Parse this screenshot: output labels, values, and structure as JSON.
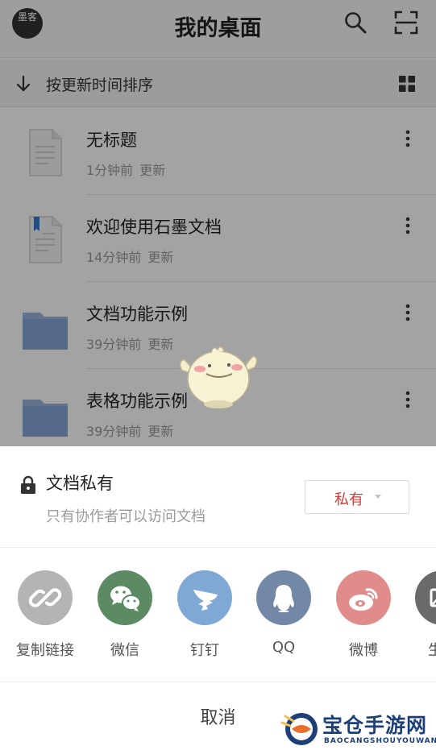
{
  "header": {
    "avatar_text": "墨客",
    "title": "我的桌面",
    "search_icon": "search-icon",
    "scan_icon": "scan-icon"
  },
  "sort": {
    "label": "按更新时间排序",
    "arrow_icon": "arrow-down-icon",
    "view_icon": "grid-view-icon"
  },
  "files": [
    {
      "name": "无标题",
      "time": "1分钟前",
      "action": "更新",
      "kind": "document"
    },
    {
      "name": "欢迎使用石墨文档",
      "time": "14分钟前",
      "action": "更新",
      "kind": "document-bookmarked"
    },
    {
      "name": "文档功能示例",
      "time": "39分钟前",
      "action": "更新",
      "kind": "folder"
    },
    {
      "name": "表格功能示例",
      "time": "39分钟前",
      "action": "更新",
      "kind": "folder"
    }
  ],
  "privacy": {
    "title": "文档私有",
    "description": "只有协作者可以访问文档",
    "selected": "私有",
    "accent_color": "#c8413b"
  },
  "share": [
    {
      "label": "复制链接",
      "icon": "link-icon",
      "color": "#b4b4b4"
    },
    {
      "label": "微信",
      "icon": "wechat-icon",
      "color": "#5b8a63"
    },
    {
      "label": "钉钉",
      "icon": "dingtalk-icon",
      "color": "#7fa9d4"
    },
    {
      "label": "QQ",
      "icon": "qq-icon",
      "color": "#7387a6"
    },
    {
      "label": "微博",
      "icon": "weibo-icon",
      "color": "#e08c8a"
    },
    {
      "label": "生成",
      "icon": "image-icon",
      "color": "#6a6a6a"
    }
  ],
  "cancel_label": "取消",
  "watermark": {
    "text": "宝仓手游网",
    "subtext": "BAOCANGSHOUYOUWANG"
  }
}
